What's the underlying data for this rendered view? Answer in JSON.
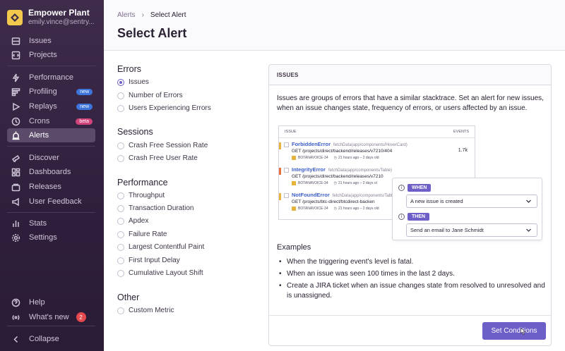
{
  "org": {
    "name": "Empower Plant",
    "user": "emily.vince@sentry..."
  },
  "nav": {
    "issues": "Issues",
    "projects": "Projects",
    "performance": "Performance",
    "profiling": "Profiling",
    "profiling_badge": "new",
    "replays": "Replays",
    "replays_badge": "new",
    "crons": "Crons",
    "crons_badge": "beta",
    "alerts": "Alerts",
    "discover": "Discover",
    "dashboards": "Dashboards",
    "releases": "Releases",
    "user_feedback": "User Feedback",
    "stats": "Stats",
    "settings": "Settings",
    "help": "Help",
    "whats_new": "What's new",
    "whats_new_count": "2",
    "collapse": "Collapse"
  },
  "breadcrumb": {
    "parent": "Alerts",
    "current": "Select Alert"
  },
  "page_title": "Select Alert",
  "groups": {
    "errors": {
      "title": "Errors",
      "options": [
        "Issues",
        "Number of Errors",
        "Users Experiencing Errors"
      ]
    },
    "sessions": {
      "title": "Sessions",
      "options": [
        "Crash Free Session Rate",
        "Crash Free User Rate"
      ]
    },
    "performance": {
      "title": "Performance",
      "options": [
        "Throughput",
        "Transaction Duration",
        "Apdex",
        "Failure Rate",
        "Largest Contentful Paint",
        "First Input Delay",
        "Cumulative Layout Shift"
      ]
    },
    "other": {
      "title": "Other",
      "options": [
        "Custom Metric"
      ]
    }
  },
  "selected_option": "Issues",
  "panel": {
    "header": "ISSUES",
    "description": "Issues are groups of errors that have a similar stacktrace. Set an alert for new issues, when an issue changes state, frequency of errors, or users affected by an issue.",
    "illustration": {
      "col_issue": "ISSUE",
      "col_events": "EVENTS",
      "rows": [
        {
          "title": "ForbiddenError",
          "func": "fetchData(app/components/HoverCard)",
          "get": "GET /projects/direct/backend/releases/v7210/404",
          "project": "BOTANAVOICE-34",
          "time": "21 hours ago – 2 days old",
          "events": "1.7k",
          "color": "#e8b33c"
        },
        {
          "title": "IntegrityError",
          "func": "fetchData(app/components/Table)",
          "get": "GET /projects/direct/backend/releases/v7210",
          "project": "BOTANAVOICE-34",
          "time": "21 hours ago – 2 days ol",
          "events": "",
          "color": "#e8703c"
        },
        {
          "title": "NotFoundError",
          "func": "fetchData(app/components/Table)",
          "get": "GET /projects/btc-direct/btcdirect-backen",
          "project": "BOTANAVOICE-34",
          "time": "21 hours ago – 2 days old",
          "events": "",
          "color": "#e8b33c"
        }
      ],
      "when_label": "WHEN",
      "when_value": "A new issue is created",
      "then_label": "THEN",
      "then_value": "Send an email to Jane Schmidt"
    },
    "examples_title": "Examples",
    "examples": [
      "When the triggering event's level is fatal.",
      "When an issue was seen 100 times in the last 2 days.",
      "Create a JIRA ticket when an issue changes state from resolved to unresolved and is unassigned."
    ],
    "button_label": "Set Conditions"
  },
  "colors": {
    "accent": "#6c5fc7",
    "sidebar": "#3e2c4a",
    "badge_new": "#3d74db",
    "badge_beta": "#d1447a"
  }
}
